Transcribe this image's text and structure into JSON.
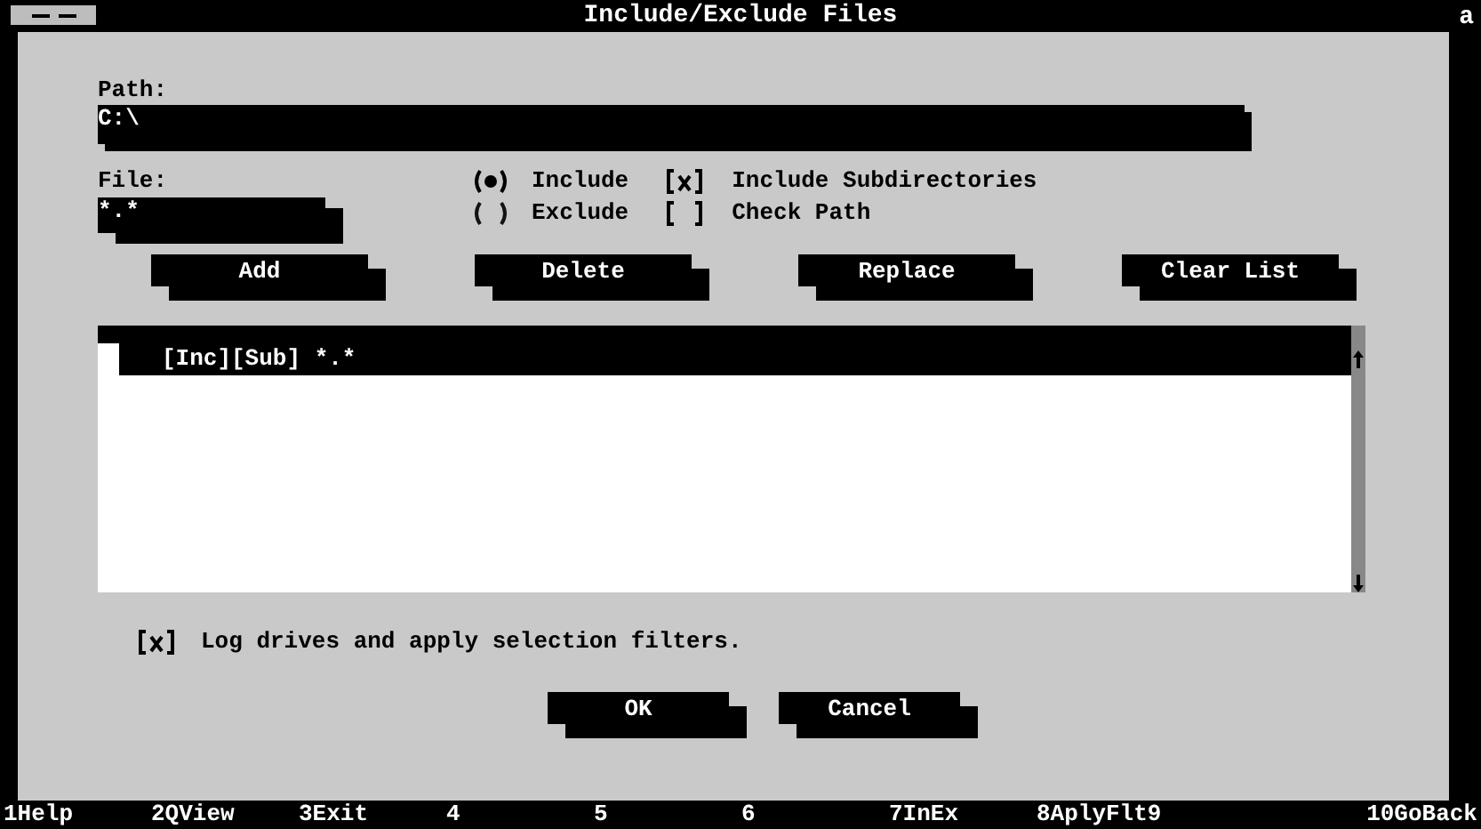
{
  "window": {
    "title": "Include/Exclude Files",
    "corner": "a"
  },
  "path": {
    "label": "Path:",
    "value": "C:\\"
  },
  "file": {
    "label": "File:",
    "value": "*.*"
  },
  "mode": [
    {
      "label": "Include",
      "selected": true
    },
    {
      "label": "Exclude",
      "selected": false
    }
  ],
  "options": [
    {
      "label": "Include Subdirectories",
      "checked": true
    },
    {
      "label": "Check Path",
      "checked": false
    }
  ],
  "buttons": [
    "Add",
    "Delete",
    "Replace",
    "Clear List"
  ],
  "list": {
    "items": [
      {
        "text": "[Inc][Sub] *.*",
        "selected": true
      }
    ]
  },
  "log_option": {
    "label": "Log drives and apply selection filters.",
    "checked": true
  },
  "dialog_buttons": [
    "OK",
    "Cancel"
  ],
  "function_keys": [
    "1Help",
    "2QView",
    "3Exit",
    "4",
    "5",
    "6",
    "7InEx",
    "8AplyFlt9",
    "10GoBack"
  ]
}
